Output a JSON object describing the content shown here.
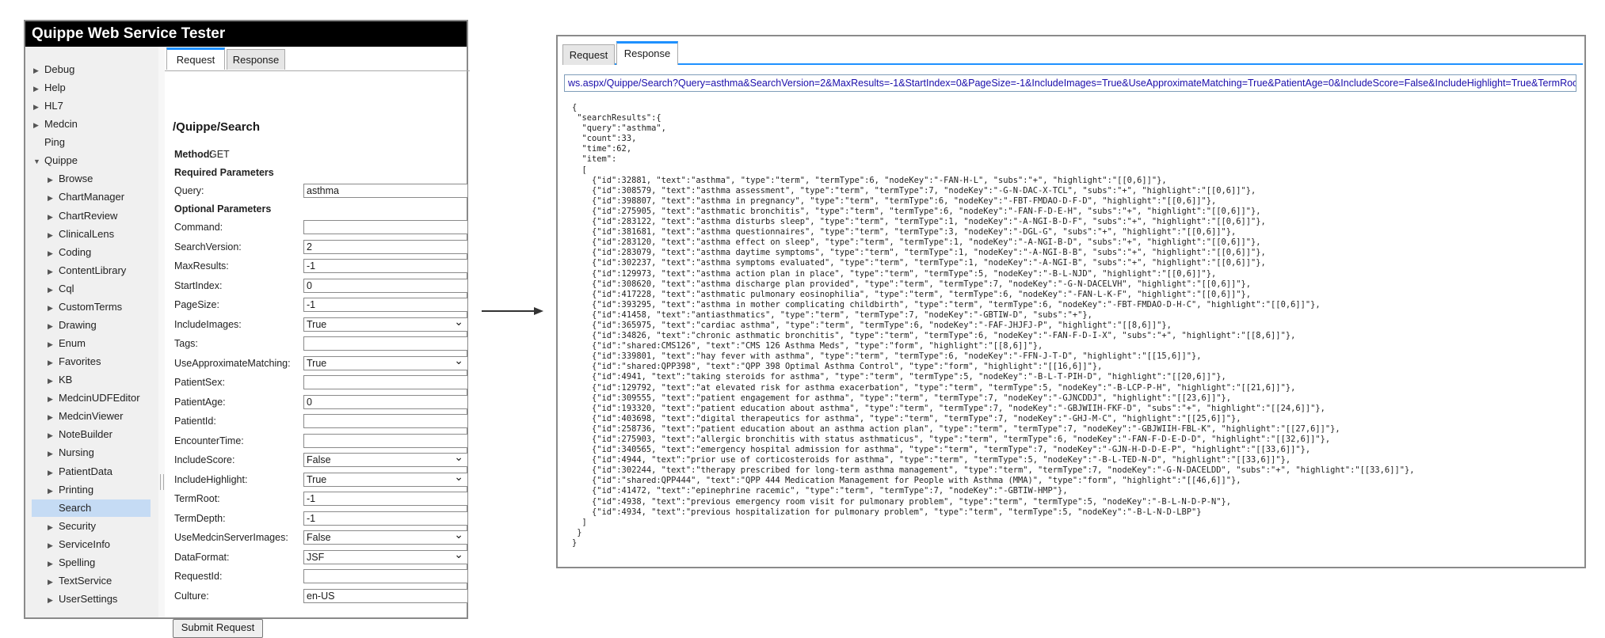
{
  "app": {
    "title": "Quippe Web Service Tester"
  },
  "sidebar": {
    "items": [
      {
        "label": "Debug",
        "expandable": true,
        "level": 0
      },
      {
        "label": "Help",
        "expandable": true,
        "level": 0
      },
      {
        "label": "HL7",
        "expandable": true,
        "level": 0
      },
      {
        "label": "Medcin",
        "expandable": true,
        "level": 0
      },
      {
        "label": "Ping",
        "expandable": false,
        "level": 0
      },
      {
        "label": "Quippe",
        "expanded": true,
        "level": 0
      },
      {
        "label": "Browse",
        "expandable": true,
        "level": 1
      },
      {
        "label": "ChartManager",
        "expandable": true,
        "level": 1
      },
      {
        "label": "ChartReview",
        "expandable": true,
        "level": 1
      },
      {
        "label": "ClinicalLens",
        "expandable": true,
        "level": 1
      },
      {
        "label": "Coding",
        "expandable": true,
        "level": 1
      },
      {
        "label": "ContentLibrary",
        "expandable": true,
        "level": 1
      },
      {
        "label": "Cql",
        "expandable": true,
        "level": 1
      },
      {
        "label": "CustomTerms",
        "expandable": true,
        "level": 1
      },
      {
        "label": "Drawing",
        "expandable": true,
        "level": 1
      },
      {
        "label": "Enum",
        "expandable": true,
        "level": 1
      },
      {
        "label": "Favorites",
        "expandable": true,
        "level": 1
      },
      {
        "label": "KB",
        "expandable": true,
        "level": 1
      },
      {
        "label": "MedcinUDFEditor",
        "expandable": true,
        "level": 1
      },
      {
        "label": "MedcinViewer",
        "expandable": true,
        "level": 1
      },
      {
        "label": "NoteBuilder",
        "expandable": true,
        "level": 1
      },
      {
        "label": "Nursing",
        "expandable": true,
        "level": 1
      },
      {
        "label": "PatientData",
        "expandable": true,
        "level": 1
      },
      {
        "label": "Printing",
        "expandable": true,
        "level": 1
      },
      {
        "label": "Search",
        "expandable": false,
        "level": 1,
        "selected": true
      },
      {
        "label": "Security",
        "expandable": true,
        "level": 1
      },
      {
        "label": "ServiceInfo",
        "expandable": true,
        "level": 1
      },
      {
        "label": "Spelling",
        "expandable": true,
        "level": 1
      },
      {
        "label": "TextService",
        "expandable": true,
        "level": 1
      },
      {
        "label": "UserSettings",
        "expandable": true,
        "level": 1
      }
    ]
  },
  "left_tabs": {
    "request": "Request",
    "response": "Response"
  },
  "request": {
    "path": "/Quippe/Search",
    "method_label": "Method:",
    "method_value": "GET",
    "required_heading": "Required Parameters",
    "optional_heading": "Optional Parameters",
    "submit_label": "Submit Request",
    "params": [
      {
        "label": "Query:",
        "value": "asthma",
        "type": "text"
      },
      {
        "label": "Command:",
        "value": "",
        "type": "text"
      },
      {
        "label": "SearchVersion:",
        "value": "2",
        "type": "text"
      },
      {
        "label": "MaxResults:",
        "value": "-1",
        "type": "text"
      },
      {
        "label": "StartIndex:",
        "value": "0",
        "type": "text"
      },
      {
        "label": "PageSize:",
        "value": "-1",
        "type": "text"
      },
      {
        "label": "IncludeImages:",
        "value": "True",
        "type": "select"
      },
      {
        "label": "Tags:",
        "value": "",
        "type": "text"
      },
      {
        "label": "UseApproximateMatching:",
        "value": "True",
        "type": "select"
      },
      {
        "label": "PatientSex:",
        "value": "",
        "type": "text"
      },
      {
        "label": "PatientAge:",
        "value": "0",
        "type": "text"
      },
      {
        "label": "PatientId:",
        "value": "",
        "type": "text"
      },
      {
        "label": "EncounterTime:",
        "value": "",
        "type": "text"
      },
      {
        "label": "IncludeScore:",
        "value": "False",
        "type": "select"
      },
      {
        "label": "IncludeHighlight:",
        "value": "True",
        "type": "select"
      },
      {
        "label": "TermRoot:",
        "value": "-1",
        "type": "text"
      },
      {
        "label": "TermDepth:",
        "value": "-1",
        "type": "text"
      },
      {
        "label": "UseMedcinServerImages:",
        "value": "False",
        "type": "select"
      },
      {
        "label": "DataFormat:",
        "value": "JSF",
        "type": "select"
      },
      {
        "label": "RequestId:",
        "value": "",
        "type": "text"
      },
      {
        "label": "Culture:",
        "value": "en-US",
        "type": "text"
      }
    ]
  },
  "right_tabs": {
    "request": "Request",
    "response": "Response"
  },
  "response": {
    "url": "ws.aspx/Quippe/Search?Query=asthma&SearchVersion=2&MaxResults=-1&StartIndex=0&PageSize=-1&IncludeImages=True&UseApproximateMatching=True&PatientAge=0&IncludeScore=False&IncludeHighlight=True&TermRoot=",
    "body": "{\n \"searchResults\":{\n  \"query\":\"asthma\",\n  \"count\":33,\n  \"time\":62,\n  \"item\":\n  [\n    {\"id\":32881, \"text\":\"asthma\", \"type\":\"term\", \"termType\":6, \"nodeKey\":\"-FAN-H-L\", \"subs\":\"+\", \"highlight\":\"[[0,6]]\"},\n    {\"id\":308579, \"text\":\"asthma assessment\", \"type\":\"term\", \"termType\":7, \"nodeKey\":\"-G-N-DAC-X-TCL\", \"subs\":\"+\", \"highlight\":\"[[0,6]]\"},\n    {\"id\":398807, \"text\":\"asthma in pregnancy\", \"type\":\"term\", \"termType\":6, \"nodeKey\":\"-FBT-FMDAO-D-F-D\", \"highlight\":\"[[0,6]]\"},\n    {\"id\":275905, \"text\":\"asthmatic bronchitis\", \"type\":\"term\", \"termType\":6, \"nodeKey\":\"-FAN-F-D-E-H\", \"subs\":\"+\", \"highlight\":\"[[0,6]]\"},\n    {\"id\":283122, \"text\":\"asthma disturbs sleep\", \"type\":\"term\", \"termType\":1, \"nodeKey\":\"-A-NGI-B-D-F\", \"subs\":\"+\", \"highlight\":\"[[0,6]]\"},\n    {\"id\":381681, \"text\":\"asthma questionnaires\", \"type\":\"term\", \"termType\":3, \"nodeKey\":\"-DGL-G\", \"subs\":\"+\", \"highlight\":\"[[0,6]]\"},\n    {\"id\":283120, \"text\":\"asthma effect on sleep\", \"type\":\"term\", \"termType\":1, \"nodeKey\":\"-A-NGI-B-D\", \"subs\":\"+\", \"highlight\":\"[[0,6]]\"},\n    {\"id\":283079, \"text\":\"asthma daytime symptoms\", \"type\":\"term\", \"termType\":1, \"nodeKey\":\"-A-NGI-B-B\", \"subs\":\"+\", \"highlight\":\"[[0,6]]\"},\n    {\"id\":302237, \"text\":\"asthma symptoms evaluated\", \"type\":\"term\", \"termType\":1, \"nodeKey\":\"-A-NGI-B\", \"subs\":\"+\", \"highlight\":\"[[0,6]]\"},\n    {\"id\":129973, \"text\":\"asthma action plan in place\", \"type\":\"term\", \"termType\":5, \"nodeKey\":\"-B-L-NJD\", \"highlight\":\"[[0,6]]\"},\n    {\"id\":308620, \"text\":\"asthma discharge plan provided\", \"type\":\"term\", \"termType\":7, \"nodeKey\":\"-G-N-DACELVH\", \"highlight\":\"[[0,6]]\"},\n    {\"id\":417228, \"text\":\"asthmatic pulmonary eosinophilia\", \"type\":\"term\", \"termType\":6, \"nodeKey\":\"-FAN-L-K-F\", \"highlight\":\"[[0,6]]\"},\n    {\"id\":393295, \"text\":\"asthma in mother complicating childbirth\", \"type\":\"term\", \"termType\":6, \"nodeKey\":\"-FBT-FMDAO-D-H-C\", \"highlight\":\"[[0,6]]\"},\n    {\"id\":41458, \"text\":\"antiasthmatics\", \"type\":\"term\", \"termType\":7, \"nodeKey\":\"-GBTIW-D\", \"subs\":\"+\"},\n    {\"id\":365975, \"text\":\"cardiac asthma\", \"type\":\"term\", \"termType\":6, \"nodeKey\":\"-FAF-JHJFJ-P\", \"highlight\":\"[[8,6]]\"},\n    {\"id\":34826, \"text\":\"chronic asthmatic bronchitis\", \"type\":\"term\", \"termType\":6, \"nodeKey\":\"-FAN-F-D-I-X\", \"subs\":\"+\", \"highlight\":\"[[8,6]]\"},\n    {\"id\":\"shared:CMS126\", \"text\":\"CMS 126 Asthma Meds\", \"type\":\"form\", \"highlight\":\"[[8,6]]\"},\n    {\"id\":339801, \"text\":\"hay fever with asthma\", \"type\":\"term\", \"termType\":6, \"nodeKey\":\"-FFN-J-T-D\", \"highlight\":\"[[15,6]]\"},\n    {\"id\":\"shared:QPP398\", \"text\":\"QPP 398 Optimal Asthma Control\", \"type\":\"form\", \"highlight\":\"[[16,6]]\"},\n    {\"id\":4941, \"text\":\"taking steroids for asthma\", \"type\":\"term\", \"termType\":5, \"nodeKey\":\"-B-L-T-PIH-D\", \"highlight\":\"[[20,6]]\"},\n    {\"id\":129792, \"text\":\"at elevated risk for asthma exacerbation\", \"type\":\"term\", \"termType\":5, \"nodeKey\":\"-B-LCP-P-H\", \"highlight\":\"[[21,6]]\"},\n    {\"id\":309555, \"text\":\"patient engagement for asthma\", \"type\":\"term\", \"termType\":7, \"nodeKey\":\"-GJNCDDJ\", \"highlight\":\"[[23,6]]\"},\n    {\"id\":193320, \"text\":\"patient education about asthma\", \"type\":\"term\", \"termType\":7, \"nodeKey\":\"-GBJWIIH-FKF-D\", \"subs\":\"+\", \"highlight\":\"[[24,6]]\"},\n    {\"id\":403698, \"text\":\"digital therapeutics for asthma\", \"type\":\"term\", \"termType\":7, \"nodeKey\":\"-GHJ-M-C\", \"highlight\":\"[[25,6]]\"},\n    {\"id\":258736, \"text\":\"patient education about an asthma action plan\", \"type\":\"term\", \"termType\":7, \"nodeKey\":\"-GBJWIIH-FBL-K\", \"highlight\":\"[[27,6]]\"},\n    {\"id\":275903, \"text\":\"allergic bronchitis with status asthmaticus\", \"type\":\"term\", \"termType\":6, \"nodeKey\":\"-FAN-F-D-E-D-D\", \"highlight\":\"[[32,6]]\"},\n    {\"id\":340565, \"text\":\"emergency hospital admission for asthma\", \"type\":\"term\", \"termType\":7, \"nodeKey\":\"-GJN-H-D-D-E-P\", \"highlight\":\"[[33,6]]\"},\n    {\"id\":4944, \"text\":\"prior use of corticosteroids for asthma\", \"type\":\"term\", \"termType\":5, \"nodeKey\":\"-B-L-TED-N-D\", \"highlight\":\"[[33,6]]\"},\n    {\"id\":302244, \"text\":\"therapy prescribed for long-term asthma management\", \"type\":\"term\", \"termType\":7, \"nodeKey\":\"-G-N-DACELDD\", \"subs\":\"+\", \"highlight\":\"[[33,6]]\"},\n    {\"id\":\"shared:QPP444\", \"text\":\"QPP 444 Medication Management for People with Asthma (MMA)\", \"type\":\"form\", \"highlight\":\"[[46,6]]\"},\n    {\"id\":41472, \"text\":\"epinephrine racemic\", \"type\":\"term\", \"termType\":7, \"nodeKey\":\"-GBTIW-HMP\"},\n    {\"id\":4938, \"text\":\"previous emergency room visit for pulmonary problem\", \"type\":\"term\", \"termType\":5, \"nodeKey\":\"-B-L-N-D-P-N\"},\n    {\"id\":4934, \"text\":\"previous hospitalization for pulmonary problem\", \"type\":\"term\", \"termType\":5, \"nodeKey\":\"-B-L-N-D-LBP\"}\n  ]\n }\n}"
  },
  "icons": {
    "expand": "triangle-right-icon",
    "collapse": "triangle-down-icon",
    "flow_arrow": "arrow-right-icon"
  }
}
